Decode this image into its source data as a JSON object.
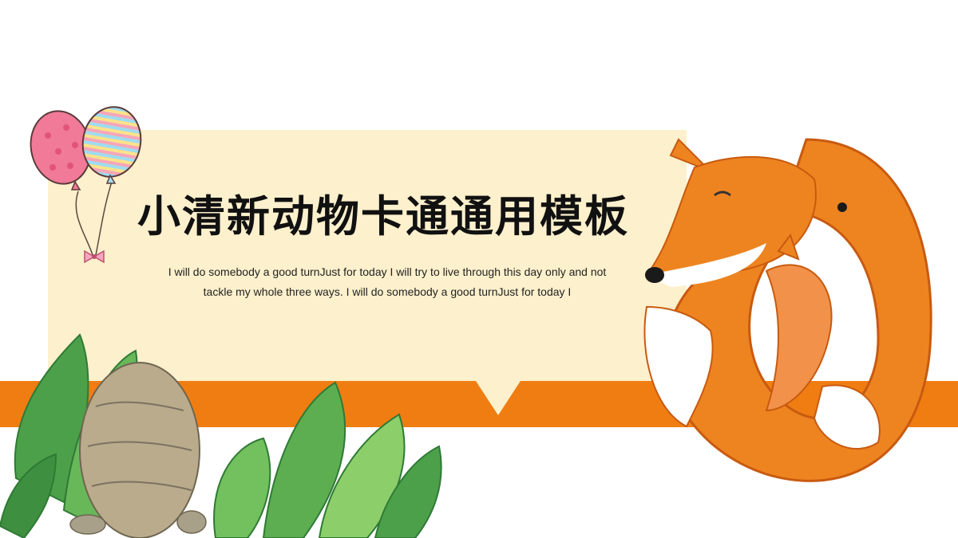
{
  "slide": {
    "title": "小清新动物卡通通用模板",
    "subtitle": "I will do somebody a good turnJust for today I will try to live through this day only and not tackle my whole three ways. I will do somebody a good turnJust for today I"
  },
  "colors": {
    "stripe": "#f07d12",
    "banner": "#fdf0cc",
    "title_text": "#111111"
  },
  "decorations": [
    "balloons-icon",
    "plants-and-rock-illustration",
    "fox-illustration"
  ]
}
